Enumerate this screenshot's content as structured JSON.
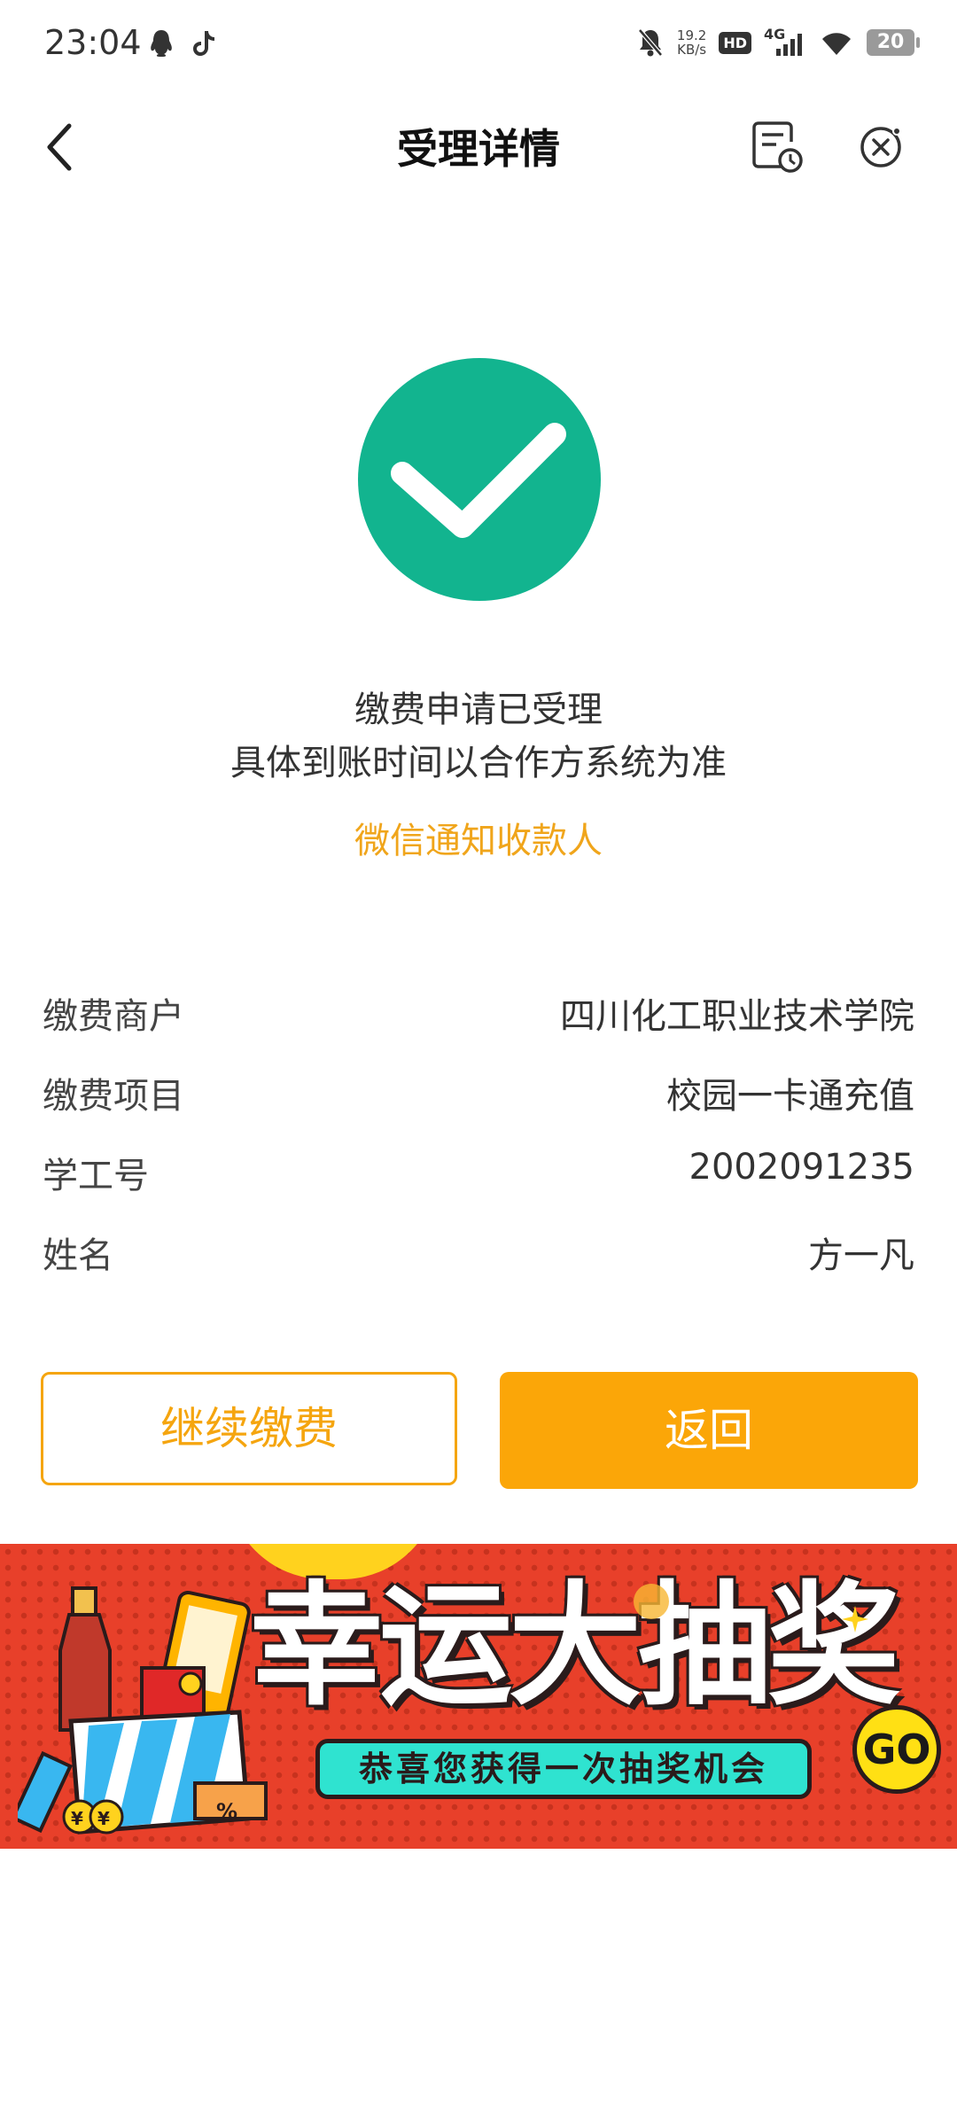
{
  "status_bar": {
    "time": "23:04",
    "speed_value": "19.2",
    "speed_unit": "KB/s",
    "hd": "HD",
    "network": "4G",
    "battery": "20"
  },
  "nav": {
    "title": "受理详情"
  },
  "result": {
    "line1": "缴费申请已受理",
    "line2": "具体到账时间以合作方系统为准",
    "notify_link": "微信通知收款人",
    "accent_color": "#12b48f"
  },
  "details": [
    {
      "label": "缴费商户",
      "value": "四川化工职业技术学院"
    },
    {
      "label": "缴费项目",
      "value": "校园一卡通充值"
    },
    {
      "label": "学工号",
      "value": "2002091235"
    },
    {
      "label": "姓名",
      "value": "方一凡"
    }
  ],
  "actions": {
    "continue_label": "继续缴费",
    "return_label": "返回",
    "brand_color": "#fba608"
  },
  "banner": {
    "title": "幸运大抽奖",
    "subtitle": "恭喜您获得一次抽奖机会",
    "go_label": "GO",
    "coupon_symbol": "%",
    "coin_symbol": "¥"
  }
}
